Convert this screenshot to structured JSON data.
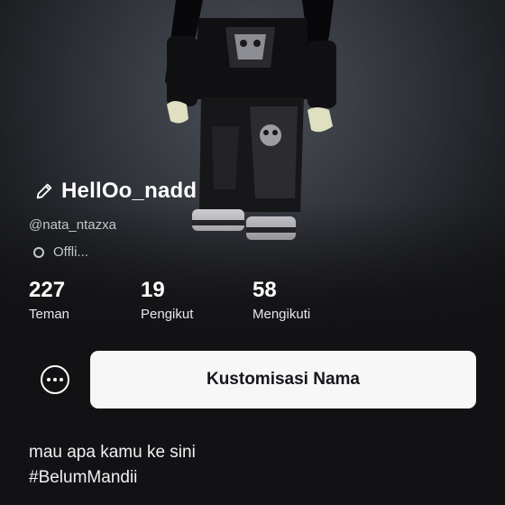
{
  "profile": {
    "display_name": "HellOo_nadd",
    "username": "@nata_ntazxa",
    "status": "Offli..."
  },
  "stats": [
    {
      "count": "227",
      "label": "Teman"
    },
    {
      "count": "19",
      "label": "Pengikut"
    },
    {
      "count": "58",
      "label": "Mengikuti"
    }
  ],
  "actions": {
    "primary_label": "Kustomisasi Nama",
    "more_icon": "ellipsis-icon"
  },
  "bio": {
    "line1": "mau apa kamu ke sini",
    "line2": "#BelumMandii"
  },
  "colors": {
    "background": "#121214",
    "button_bg": "#f7f7f8",
    "button_text": "#15161a",
    "secondary_text": "#c4c6cc"
  }
}
